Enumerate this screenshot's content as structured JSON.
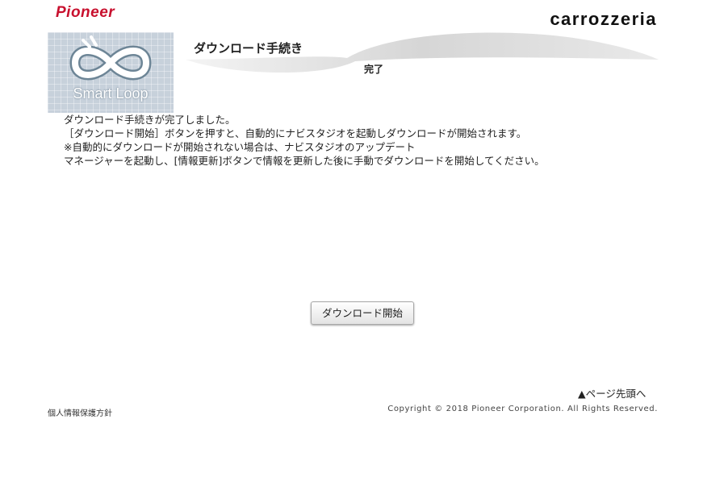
{
  "header": {
    "brand_logo": "Pioneer",
    "product_logo": "carrozzeria",
    "badge_text": "Smart Loop",
    "page_title": "ダウンロード手続き",
    "step_label": "完了"
  },
  "main": {
    "message_lines": [
      "ダウンロード手続きが完了しました。",
      "［ダウンロード開始］ボタンを押すと、自動的にナビスタジオを起動しダウンロードが開始されます。",
      "※自動的にダウンロードが開始されない場合は、ナビスタジオのアップデート",
      "マネージャーを起動し、[情報更新]ボタンで情報を更新した後に手動でダウンロードを開始してください。"
    ],
    "download_button_label": "ダウンロード開始"
  },
  "footer": {
    "page_top_link": "▲ページ先頭へ",
    "privacy_link": "個人情報保護方針",
    "copyright": "Copyright © 2018 Pioneer Corporation. All Rights Reserved."
  },
  "colors": {
    "brand_red": "#c8102e",
    "badge_bg": "#c7d1db",
    "swoosh": "#d9d9d9"
  }
}
